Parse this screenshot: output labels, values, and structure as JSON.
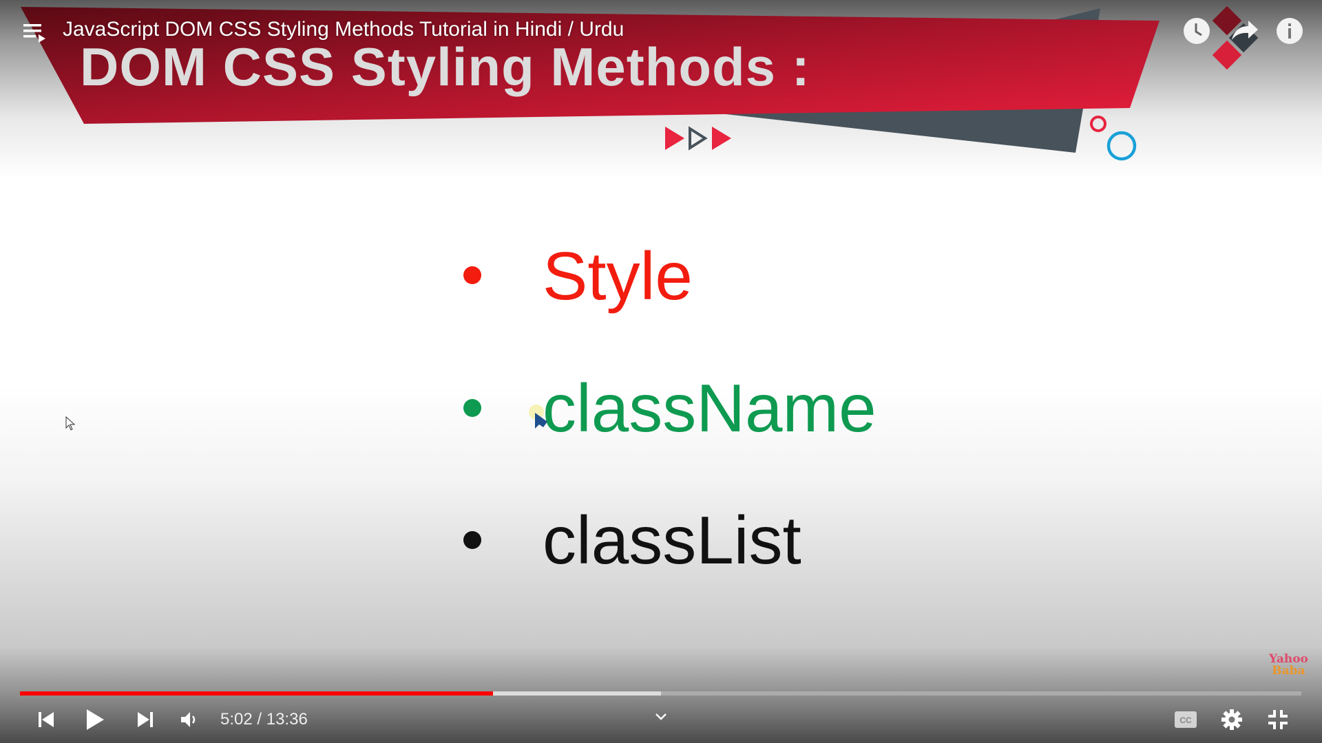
{
  "video": {
    "title": "JavaScript DOM CSS Styling Methods Tutorial in Hindi / Urdu",
    "slide_title": "DOM CSS Styling Methods :",
    "items": [
      {
        "label": "Style",
        "color": "#f21c0f"
      },
      {
        "label": "className",
        "color": "#0e9a50"
      },
      {
        "label": "classList",
        "color": "#111111"
      }
    ],
    "watermark": {
      "line1": "Yahoo",
      "line2": "Baba"
    }
  },
  "player": {
    "current_time": "5:02",
    "separator": " / ",
    "duration": "13:36",
    "played_fraction": 0.369,
    "buffered_fraction": 0.5,
    "accent_color": "#ff0000",
    "icons": [
      "playlist-icon",
      "watch-later-icon",
      "share-icon",
      "info-icon",
      "previous-icon",
      "play-icon",
      "next-icon",
      "volume-icon",
      "chevron-down-icon",
      "captions-icon",
      "settings-icon",
      "exit-fullscreen-icon"
    ]
  }
}
